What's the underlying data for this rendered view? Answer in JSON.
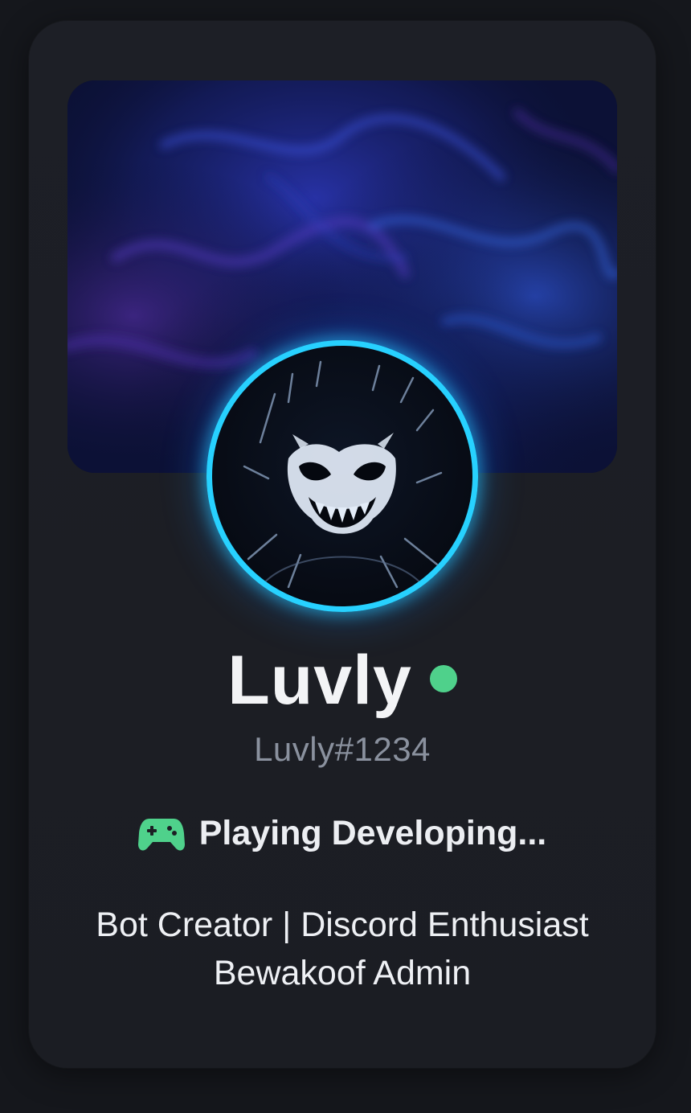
{
  "profile": {
    "display_name": "Luvly",
    "tag": "Luvly#1234",
    "status": "online",
    "status_color": "#4fd18b",
    "activity": {
      "icon": "gamepad-icon",
      "text": "Playing Developing..."
    },
    "bio_lines": [
      "Bot Creator | Discord Enthusiast",
      "Bewakoof Admin"
    ]
  },
  "theme": {
    "background": "#15171c",
    "card": "#1c1e24",
    "avatar_ring": "#27d1ff",
    "banner_colors": [
      "#0b1030",
      "#2a2aa0",
      "#4b2a8c"
    ]
  },
  "avatar": {
    "icon": "grinning-monster-avatar"
  }
}
